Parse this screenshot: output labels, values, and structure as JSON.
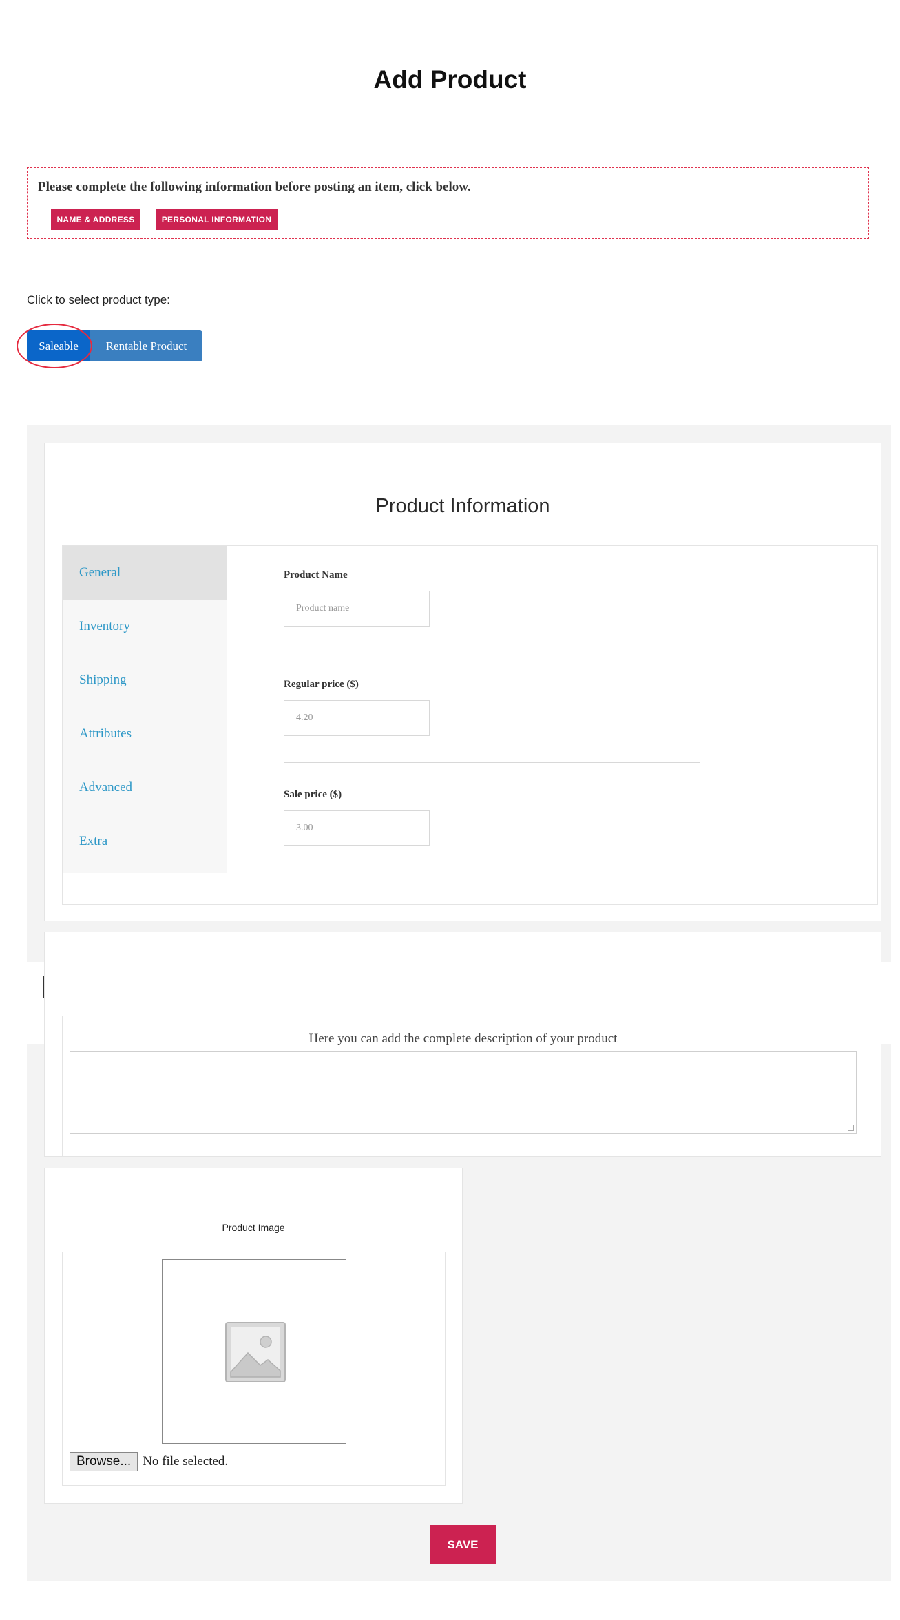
{
  "page": {
    "title": "Add Product"
  },
  "notice": {
    "message": "Please complete the following information before posting an item, click below.",
    "buttons": [
      "NAME & ADDRESS",
      "PERSONAL INFORMATION"
    ]
  },
  "product_type": {
    "label": "Click to select product type:",
    "options": [
      "Saleable",
      "Rentable Product"
    ],
    "selected": "Saleable"
  },
  "product_info": {
    "heading": "Product Information",
    "tabs": [
      "General",
      "Inventory",
      "Shipping",
      "Attributes",
      "Advanced",
      "Extra"
    ],
    "active_tab": "General",
    "fields": {
      "name_label": "Product Name",
      "name_placeholder": "Product name",
      "regular_price_label": "Regular price ($)",
      "regular_price_placeholder": "4.20",
      "sale_price_label": "Sale price ($)",
      "sale_price_placeholder": "3.00"
    }
  },
  "description": {
    "caption": "Here you can add the complete description of your product"
  },
  "image": {
    "heading": "Product Image",
    "browse_label": "Browse...",
    "file_status": "No file selected."
  },
  "actions": {
    "save_label": "SAVE"
  },
  "colors": {
    "accent": "#cc2251",
    "link": "#2e98c7",
    "selected_type": "#0b66c9",
    "type_button": "#3a7fc0",
    "highlight": "#e52a3f"
  }
}
